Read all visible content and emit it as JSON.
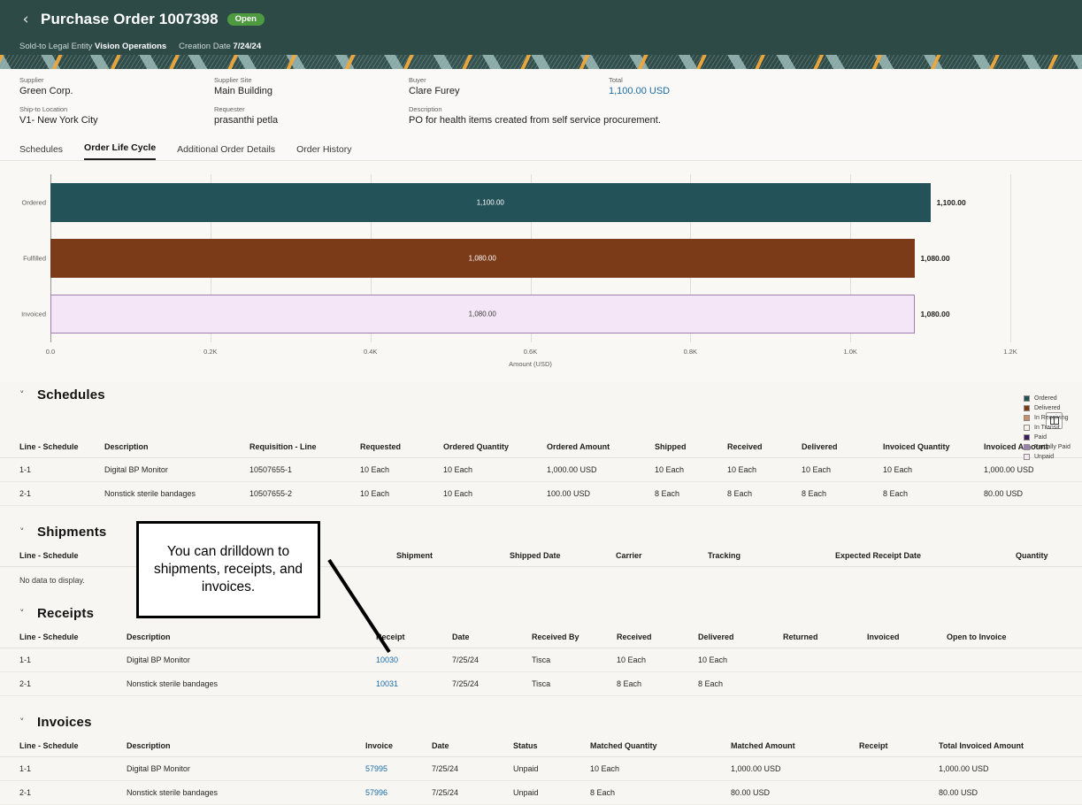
{
  "header": {
    "back_icon": "chevron-left-icon",
    "title": "Purchase Order 1007398",
    "status": "Open",
    "meta": [
      {
        "label": "Sold-to Legal Entity",
        "value": "Vision Operations"
      },
      {
        "label": "Creation Date",
        "value": "7/24/24"
      }
    ]
  },
  "attributes": [
    {
      "label": "Supplier",
      "value": "Green Corp.",
      "link": false
    },
    {
      "label": "Supplier Site",
      "value": "Main Building",
      "link": false
    },
    {
      "label": "Buyer",
      "value": "Clare Furey",
      "link": false
    },
    {
      "label": "Total",
      "value": "1,100.00 USD",
      "link": true
    },
    {
      "label": "Ship-to Location",
      "value": "V1- New York City",
      "link": false
    },
    {
      "label": "Requester",
      "value": "prasanthi petla",
      "link": false
    },
    {
      "label": "Description",
      "value": "PO for health items created from self service procurement.",
      "link": false
    }
  ],
  "tabs": [
    {
      "label": "Schedules",
      "active": false
    },
    {
      "label": "Order Life Cycle",
      "active": true
    },
    {
      "label": "Additional Order Details",
      "active": false
    },
    {
      "label": "Order History",
      "active": false
    }
  ],
  "chart_data": {
    "type": "bar",
    "orientation": "horizontal",
    "title": "",
    "xlabel": "Amount (USD)",
    "ylabel": "",
    "categories": [
      "Ordered",
      "Fulfilled",
      "Invoiced"
    ],
    "values": [
      1100.0,
      1080.0,
      1080.0
    ],
    "value_labels": [
      "1,100.00",
      "1,080.00",
      "1,080.00"
    ],
    "bar_colors": [
      "#245259",
      "#7b3a18",
      "#f4e6f7"
    ],
    "bar_border_colors": [
      "#245259",
      "#7b3a18",
      "#9f7fae"
    ],
    "xlim": [
      0,
      1200
    ],
    "xticks": [
      0,
      200,
      400,
      600,
      800,
      1000,
      1200
    ],
    "xtick_labels": [
      "0.0",
      "0.2K",
      "0.4K",
      "0.6K",
      "0.8K",
      "1.0K",
      "1.2K"
    ],
    "grid": true,
    "legend_position": "right",
    "legend": [
      {
        "label": "Ordered",
        "color": "#245259"
      },
      {
        "label": "Delivered",
        "color": "#7b3a18"
      },
      {
        "label": "In Receiving",
        "color": "#c98e6b"
      },
      {
        "label": "In Transit",
        "color": "#fbf4ee"
      },
      {
        "label": "Paid",
        "color": "#3c1a5b"
      },
      {
        "label": "Partially Paid",
        "color": "#9b7fb5"
      },
      {
        "label": "Unpaid",
        "color": "#f4e6f7"
      }
    ]
  },
  "panel_toggle_icon": "columns-panel-icon",
  "sections": {
    "schedules": {
      "title": "Schedules",
      "chevron": "chevron-down-icon",
      "columns": [
        "Line - Schedule",
        "Description",
        "Requisition - Line",
        "Requested",
        "Ordered Quantity",
        "Ordered Amount",
        "Shipped",
        "Received",
        "Delivered",
        "Invoiced Quantity",
        "Invoiced Amount"
      ],
      "rows": [
        [
          "1-1",
          "Digital BP Monitor",
          "10507655-1",
          "10 Each",
          "10 Each",
          "1,000.00 USD",
          "10 Each",
          "10 Each",
          "10 Each",
          "10 Each",
          "1,000.00 USD"
        ],
        [
          "2-1",
          "Nonstick sterile bandages",
          "10507655-2",
          "10 Each",
          "10 Each",
          "100.00 USD",
          "8 Each",
          "8 Each",
          "8 Each",
          "8 Each",
          "80.00 USD"
        ]
      ]
    },
    "shipments": {
      "title": "Shipments",
      "chevron": "chevron-down-icon",
      "columns": [
        "Line - Schedule",
        "",
        "Shipment",
        "Shipped Date",
        "Carrier",
        "Tracking",
        "Expected Receipt Date",
        "Quantity"
      ],
      "rows": [],
      "empty_text": "No data to display."
    },
    "receipts": {
      "title": "Receipts",
      "chevron": "chevron-down-icon",
      "columns": [
        "Line - Schedule",
        "Description",
        "Receipt",
        "Date",
        "Received By",
        "Received",
        "Delivered",
        "Returned",
        "Invoiced",
        "Open to Invoice"
      ],
      "rows": [
        [
          "1-1",
          "Digital BP Monitor",
          "10030",
          "7/25/24",
          "Tisca",
          "10 Each",
          "10 Each",
          "",
          "",
          ""
        ],
        [
          "2-1",
          "Nonstick sterile bandages",
          "10031",
          "7/25/24",
          "Tisca",
          "8 Each",
          "8 Each",
          "",
          "",
          ""
        ]
      ],
      "link_column": 2
    },
    "invoices": {
      "title": "Invoices",
      "chevron": "chevron-down-icon",
      "columns": [
        "Line - Schedule",
        "Description",
        "Invoice",
        "Date",
        "Status",
        "Matched Quantity",
        "Matched Amount",
        "Receipt",
        "Total Invoiced Amount"
      ],
      "rows": [
        [
          "1-1",
          "Digital BP Monitor",
          "57995",
          "7/25/24",
          "Unpaid",
          "10 Each",
          "1,000.00 USD",
          "",
          "1,000.00 USD"
        ],
        [
          "2-1",
          "Nonstick sterile bandages",
          "57996",
          "7/25/24",
          "Unpaid",
          "8 Each",
          "80.00 USD",
          "",
          "80.00 USD"
        ]
      ],
      "link_column": 2
    }
  },
  "annotation": {
    "text": "You can drilldown to shipments, receipts, and invoices."
  }
}
